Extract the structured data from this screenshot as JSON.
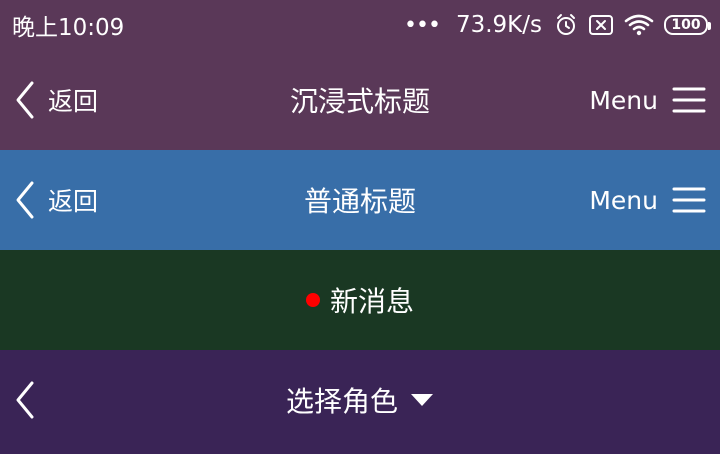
{
  "status_bar": {
    "time": "晚上10:09",
    "dots": "•••",
    "net_speed": "73.9K/s",
    "icons": [
      "alarm-icon",
      "no-sim-icon",
      "wifi-icon"
    ],
    "battery": "100"
  },
  "immersive_bar": {
    "back_label": "返回",
    "title": "沉浸式标题",
    "menu_label": "Menu",
    "background": "#5a3858"
  },
  "normal_bar": {
    "back_label": "返回",
    "title": "普通标题",
    "menu_label": "Menu",
    "background": "#386ea8"
  },
  "message_bar": {
    "title": "新消息",
    "dot_color": "#ff0000",
    "background": "#1a3823"
  },
  "role_bar": {
    "title": "选择角色",
    "background": "#3a2456"
  }
}
